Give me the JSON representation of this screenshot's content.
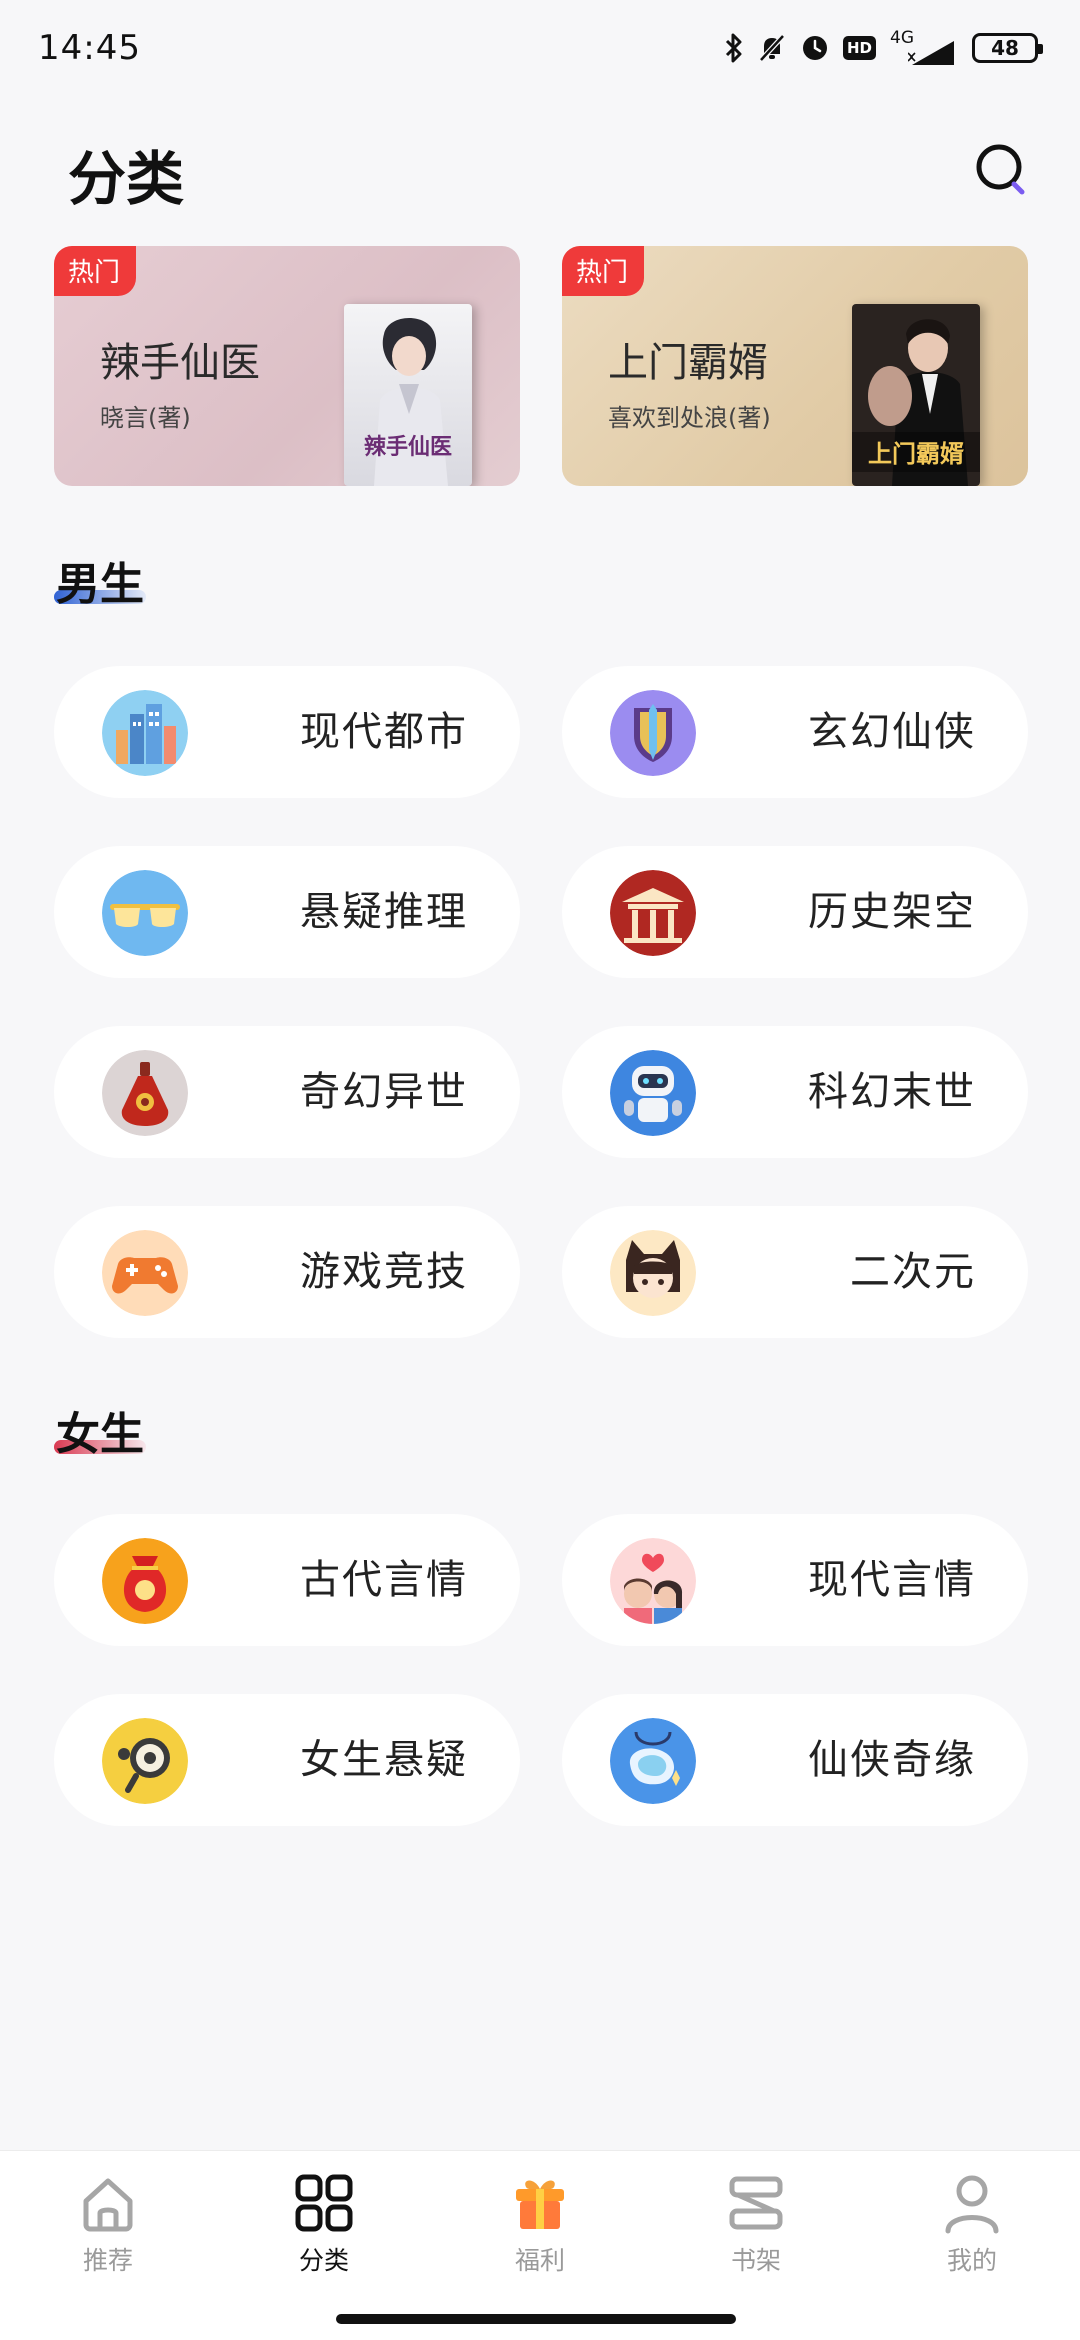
{
  "status_bar": {
    "time": "14:45",
    "network": "4G",
    "hd": "HD",
    "battery": "48"
  },
  "header": {
    "title": "分类",
    "search_icon": "search-icon"
  },
  "banners": [
    {
      "tag": "热门",
      "title": "辣手仙医",
      "author": "晓言(著)",
      "cover_text": "辣手仙医"
    },
    {
      "tag": "热门",
      "title": "上门霸婿",
      "author": "喜欢到处浪(著)",
      "cover_text": "上门霸婿"
    }
  ],
  "sections": {
    "male": {
      "title": "男生",
      "accent": "#3b6fd6",
      "items": [
        {
          "label": "现代都市",
          "icon": "city-icon"
        },
        {
          "label": "玄幻仙侠",
          "icon": "sword-shield-icon"
        },
        {
          "label": "悬疑推理",
          "icon": "sunglasses-icon"
        },
        {
          "label": "历史架空",
          "icon": "palace-icon"
        },
        {
          "label": "奇幻异世",
          "icon": "potion-icon"
        },
        {
          "label": "科幻末世",
          "icon": "robot-icon"
        },
        {
          "label": "游戏竞技",
          "icon": "gamepad-icon"
        },
        {
          "label": "二次元",
          "icon": "anime-girl-icon"
        }
      ]
    },
    "female": {
      "title": "女生",
      "accent": "#e0475b",
      "items": [
        {
          "label": "古代言情",
          "icon": "lucky-bag-icon"
        },
        {
          "label": "现代言情",
          "icon": "couple-icon"
        },
        {
          "label": "女生悬疑",
          "icon": "magnifier-face-icon"
        },
        {
          "label": "仙侠奇缘",
          "icon": "jade-pendant-icon"
        }
      ]
    }
  },
  "bottom_nav": [
    {
      "label": "推荐",
      "icon": "home-icon",
      "active": false
    },
    {
      "label": "分类",
      "icon": "grid-icon",
      "active": true
    },
    {
      "label": "福利",
      "icon": "gift-icon",
      "active": false
    },
    {
      "label": "书架",
      "icon": "bookshelf-icon",
      "active": false
    },
    {
      "label": "我的",
      "icon": "user-icon",
      "active": false
    }
  ],
  "colors": {
    "hot_tag": "#ef3a3a",
    "background": "#f7f7f9",
    "nav_active": "#111111",
    "nav_inactive": "#9a9a9a"
  }
}
